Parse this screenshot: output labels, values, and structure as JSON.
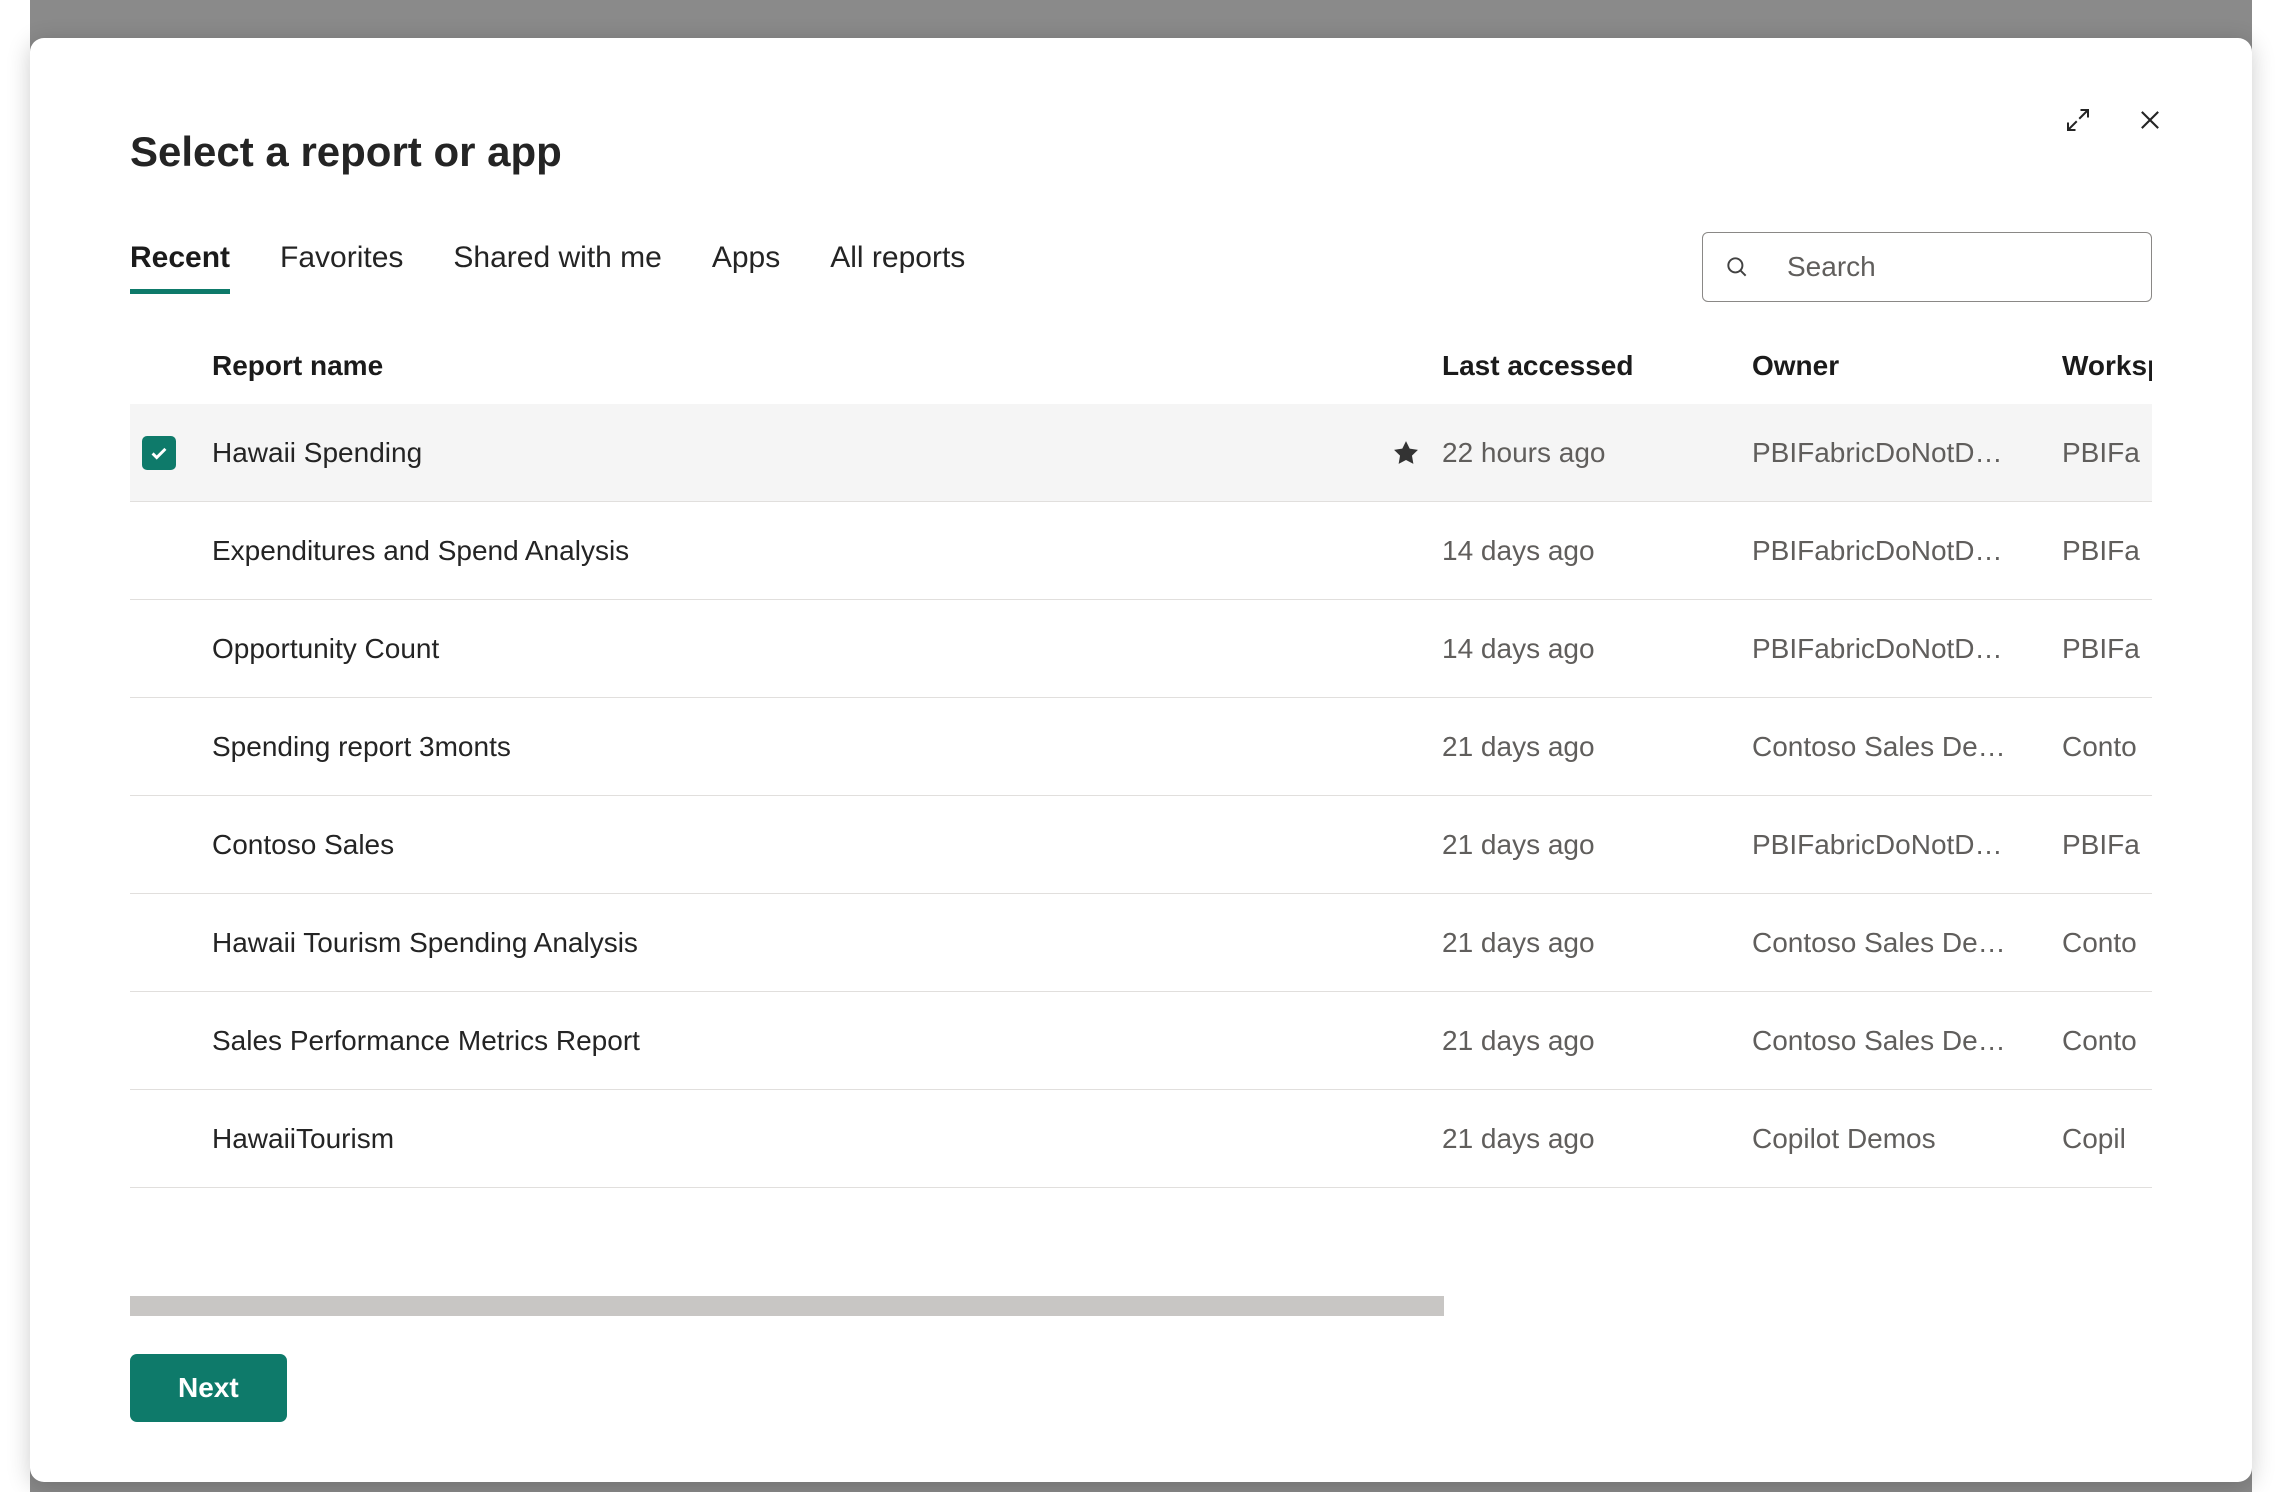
{
  "dialog": {
    "title": "Select a report or app",
    "expand_icon": "expand",
    "close_icon": "close"
  },
  "tabs": [
    {
      "label": "Recent",
      "active": true
    },
    {
      "label": "Favorites",
      "active": false
    },
    {
      "label": "Shared with me",
      "active": false
    },
    {
      "label": "Apps",
      "active": false
    },
    {
      "label": "All reports",
      "active": false
    }
  ],
  "search": {
    "placeholder": "Search"
  },
  "columns": {
    "name": "Report name",
    "last": "Last accessed",
    "owner": "Owner",
    "workspace": "Worksp"
  },
  "rows": [
    {
      "selected": true,
      "favorite": true,
      "name": "Hawaii Spending",
      "last": "22 hours ago",
      "owner": "PBIFabricDoNotD…",
      "workspace": "PBIFa"
    },
    {
      "selected": false,
      "favorite": false,
      "name": "Expenditures and Spend Analysis",
      "last": "14 days ago",
      "owner": "PBIFabricDoNotD…",
      "workspace": "PBIFa"
    },
    {
      "selected": false,
      "favorite": false,
      "name": "Opportunity Count",
      "last": "14 days ago",
      "owner": "PBIFabricDoNotD…",
      "workspace": "PBIFa"
    },
    {
      "selected": false,
      "favorite": false,
      "name": "Spending report 3monts",
      "last": "21 days ago",
      "owner": "Contoso Sales De…",
      "workspace": "Conto"
    },
    {
      "selected": false,
      "favorite": false,
      "name": "Contoso Sales",
      "last": "21 days ago",
      "owner": "PBIFabricDoNotD…",
      "workspace": "PBIFa"
    },
    {
      "selected": false,
      "favorite": false,
      "name": "Hawaii Tourism Spending Analysis",
      "last": "21 days ago",
      "owner": "Contoso Sales De…",
      "workspace": "Conto"
    },
    {
      "selected": false,
      "favorite": false,
      "name": "Sales Performance Metrics Report",
      "last": "21 days ago",
      "owner": "Contoso Sales De…",
      "workspace": "Conto"
    },
    {
      "selected": false,
      "favorite": false,
      "name": "HawaiiTourism",
      "last": "21 days ago",
      "owner": "Copilot Demos",
      "workspace": "Copil"
    }
  ],
  "footer": {
    "next_label": "Next"
  }
}
